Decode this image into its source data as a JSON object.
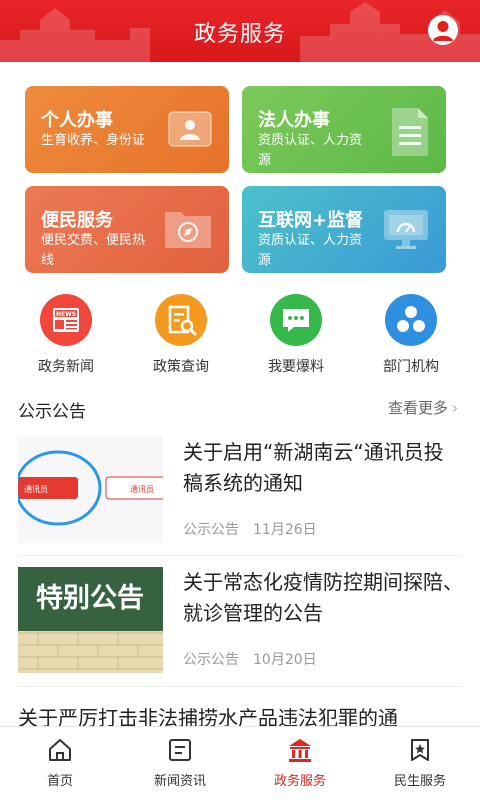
{
  "header": {
    "title": "政务服务",
    "avatar_icon": "user-icon"
  },
  "cards": [
    {
      "title": "个人办事",
      "subtitle": "生育收养、身份证",
      "icon": "id-card-icon",
      "color": "#e97a32"
    },
    {
      "title": "法人办事",
      "subtitle": "资质认证、人力资源",
      "icon": "document-icon",
      "color": "#69bf4f"
    },
    {
      "title": "便民服务",
      "subtitle": "便民交费、便民热线",
      "icon": "folder-compass-icon",
      "color": "#e76b47"
    },
    {
      "title": "互联网+监督",
      "subtitle": "资质认证、人力资源",
      "icon": "monitor-icon",
      "color": "#43aed0"
    }
  ],
  "quick": [
    {
      "label": "政务新闻",
      "icon": "news-icon",
      "color": "#f0463c"
    },
    {
      "label": "政策查询",
      "icon": "policy-search-icon",
      "color": "#f59a1f"
    },
    {
      "label": "我要爆料",
      "icon": "chat-icon",
      "color": "#36b94a"
    },
    {
      "label": "部门机构",
      "icon": "org-icon",
      "color": "#2f8fe0"
    }
  ],
  "announcements": {
    "title": "公示公告",
    "more": "查看更多",
    "items": [
      {
        "title": "关于启用“新湖南云“通讯员投稿系统的通知",
        "category": "公示公告",
        "date": "11月26日",
        "thumb_texts": [
          "通讯员",
          "通讯员"
        ]
      },
      {
        "title": "关于常态化疫情防控期间探陪、就诊管理的公告",
        "category": "公示公告",
        "date": "10月20日",
        "thumb_text": "特别公告"
      },
      {
        "title": "关于严厉打击非法捕捞水产品违法犯罪的通"
      }
    ]
  },
  "tabs": [
    {
      "label": "首页",
      "icon": "home-icon",
      "active": false
    },
    {
      "label": "新闻资讯",
      "icon": "news-list-icon",
      "active": false
    },
    {
      "label": "政务服务",
      "icon": "government-building-icon",
      "active": true
    },
    {
      "label": "民生服务",
      "icon": "bookmark-star-icon",
      "active": false
    }
  ],
  "colors": {
    "brand_red": "#e0261f",
    "header_red": "#e1201f"
  }
}
